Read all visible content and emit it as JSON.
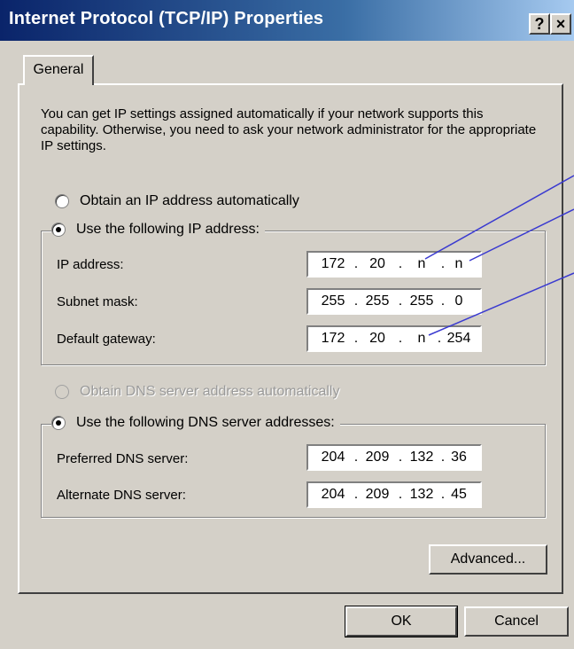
{
  "window": {
    "title": "Internet Protocol (TCP/IP) Properties",
    "help_label": "?",
    "close_label": "×"
  },
  "tabs": [
    {
      "label": "General"
    }
  ],
  "intro": "You can get IP settings assigned automatically if your network supports this capability. Otherwise, you need to ask your network administrator for the appropriate IP settings.",
  "ip_section": {
    "auto_label": "Obtain an IP address automatically",
    "manual_label": "Use the following IP address:",
    "fields": [
      {
        "label": "IP address:",
        "octets": [
          "172",
          "20",
          "n",
          "n"
        ]
      },
      {
        "label": "Subnet mask:",
        "octets": [
          "255",
          "255",
          "255",
          "0"
        ]
      },
      {
        "label": "Default gateway:",
        "octets": [
          "172",
          "20",
          "n",
          "254"
        ]
      }
    ]
  },
  "dns_section": {
    "auto_label": "Obtain DNS server address automatically",
    "manual_label": "Use the following DNS server addresses:",
    "fields": [
      {
        "label": "Preferred DNS server:",
        "octets": [
          "204",
          "209",
          "132",
          "36"
        ]
      },
      {
        "label": "Alternate DNS server:",
        "octets": [
          "204",
          "209",
          "132",
          "45"
        ]
      }
    ]
  },
  "buttons": {
    "advanced": "Advanced...",
    "ok": "OK",
    "cancel": "Cancel"
  },
  "colors": {
    "dialog_bg": "#d4d0c8",
    "titlebar_start": "#0a246a",
    "titlebar_end": "#a6caf0",
    "annotation": "#3a3ad0"
  }
}
